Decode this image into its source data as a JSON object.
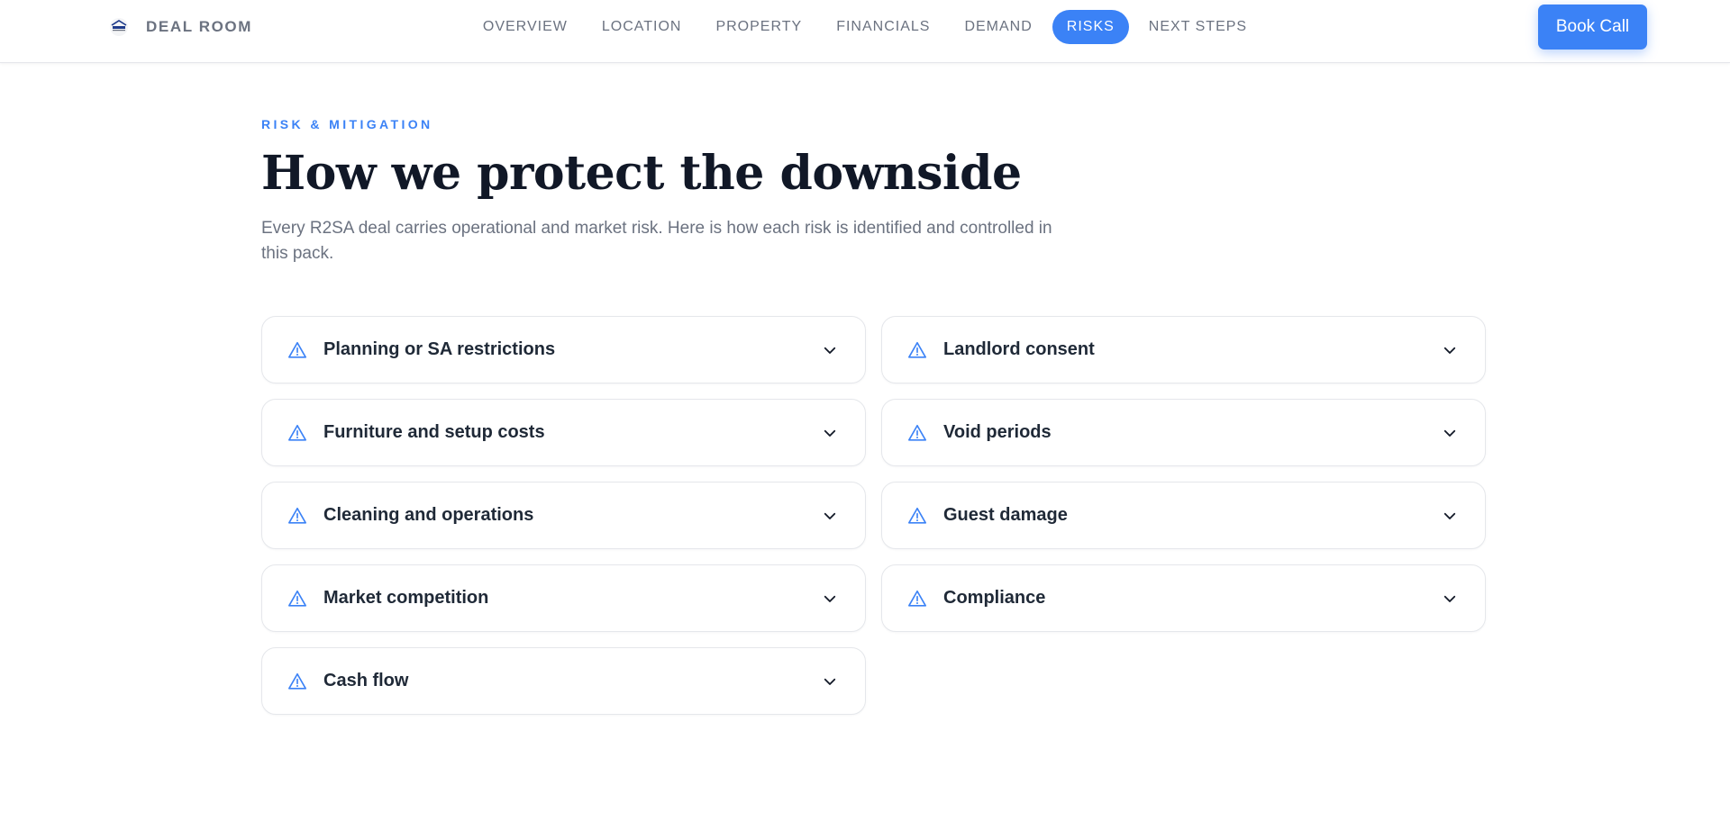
{
  "header": {
    "brand_name": "DEAL ROOM",
    "nav": [
      {
        "label": "OVERVIEW",
        "active": false
      },
      {
        "label": "LOCATION",
        "active": false
      },
      {
        "label": "PROPERTY",
        "active": false
      },
      {
        "label": "FINANCIALS",
        "active": false
      },
      {
        "label": "DEMAND",
        "active": false
      },
      {
        "label": "RISKS",
        "active": true
      },
      {
        "label": "NEXT STEPS",
        "active": false
      }
    ],
    "cta_label": "Book Call"
  },
  "section": {
    "eyebrow": "RISK & MITIGATION",
    "title": "How we protect the downside",
    "subtitle": "Every R2SA deal carries operational and market risk. Here is how each risk is identified and controlled in this pack.",
    "risks": [
      {
        "label": "Planning or SA restrictions",
        "icon": "warning-icon",
        "expanded": false
      },
      {
        "label": "Landlord consent",
        "icon": "warning-icon",
        "expanded": false
      },
      {
        "label": "Furniture and setup costs",
        "icon": "warning-icon",
        "expanded": false
      },
      {
        "label": "Void periods",
        "icon": "warning-icon",
        "expanded": false
      },
      {
        "label": "Cleaning and operations",
        "icon": "warning-icon",
        "expanded": false
      },
      {
        "label": "Guest damage",
        "icon": "warning-icon",
        "expanded": false
      },
      {
        "label": "Market competition",
        "icon": "warning-icon",
        "expanded": false
      },
      {
        "label": "Compliance",
        "icon": "warning-icon",
        "expanded": false
      },
      {
        "label": "Cash flow",
        "icon": "warning-icon",
        "expanded": false
      }
    ]
  },
  "colors": {
    "accent": "#3b82f6",
    "heading": "#111827",
    "muted": "#6b7280",
    "border": "#e5e7eb"
  }
}
